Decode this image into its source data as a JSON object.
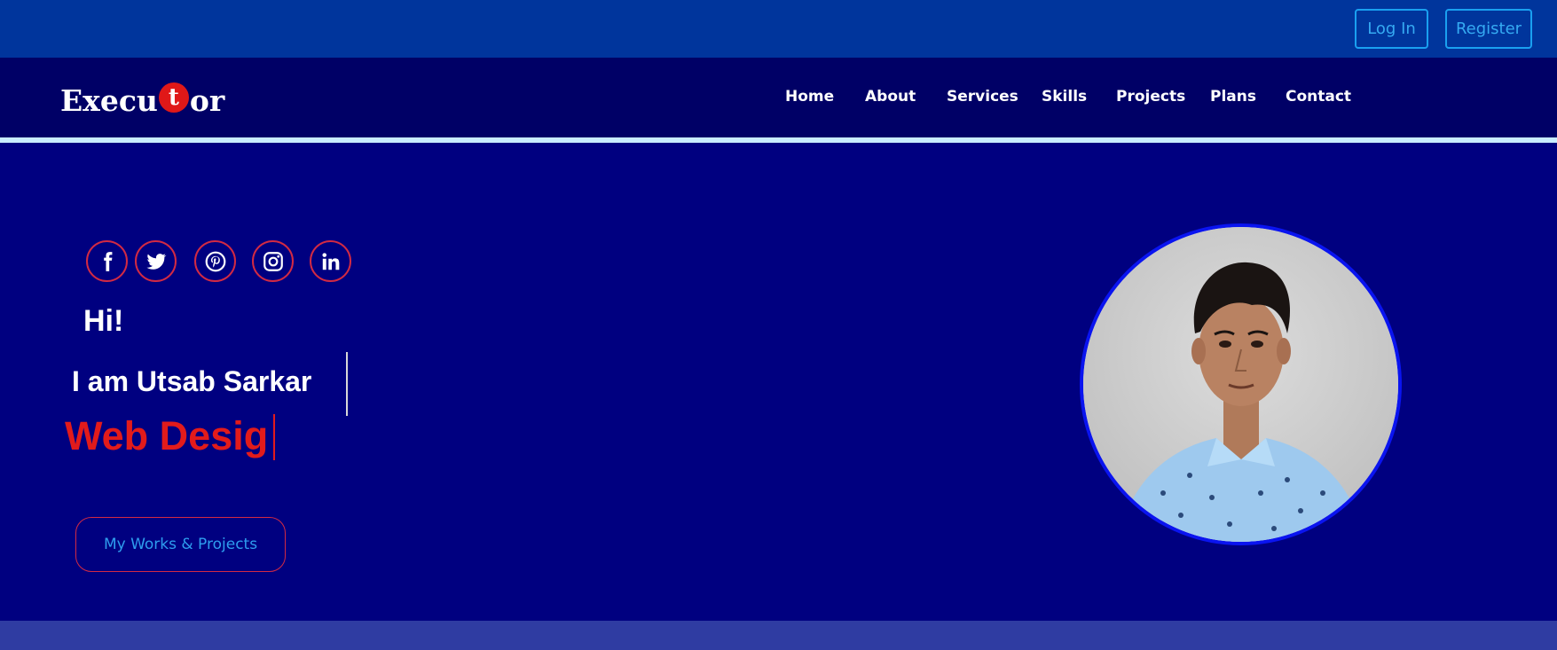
{
  "auth": {
    "login_label": "Log In",
    "register_label": "Register"
  },
  "brand": {
    "logo_prefix": "Execu",
    "logo_t": "t",
    "logo_suffix": "or"
  },
  "nav": {
    "items": [
      {
        "label": "Home"
      },
      {
        "label": "About"
      },
      {
        "label": "Services"
      },
      {
        "label": "Skills"
      },
      {
        "label": "Projects"
      },
      {
        "label": "Plans"
      },
      {
        "label": "Contact"
      }
    ]
  },
  "social": [
    "facebook-icon",
    "twitter-icon",
    "pinterest-icon",
    "instagram-icon",
    "linkedin-icon"
  ],
  "hero": {
    "greeting": "Hi!",
    "intro": "I am Utsab Sarkar",
    "role_typing": "Web Desig",
    "cta_label": "My Works & Projects"
  },
  "colors": {
    "topbar": "#00359c",
    "navbar": "#000066",
    "hero_bg": "#000080",
    "accent_red": "#e21b1b",
    "accent_blue": "#35aaf2"
  }
}
